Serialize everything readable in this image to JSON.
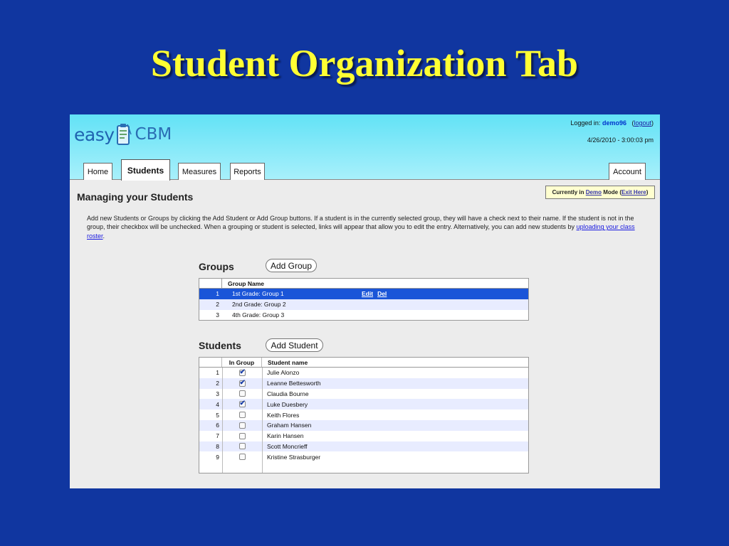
{
  "slide": {
    "title": "Student Organization Tab"
  },
  "app": {
    "logo_easy": "easy",
    "logo_cbm": "CBM",
    "login_prefix": "Logged in:",
    "username": "demo96",
    "logout_label": "logout",
    "datetime": "4/26/2010 - 3:00:03 pm"
  },
  "tabs": [
    "Home",
    "Students",
    "Measures",
    "Reports",
    "Account"
  ],
  "page": {
    "title": "Managing your Students",
    "demo_prefix": "Currently in",
    "demo_link": "Demo",
    "demo_mode": "Mode (",
    "demo_exit": "Exit Here",
    "demo_suffix": ")",
    "intro": "Add new Students or Groups by clicking the Add Student or Add Group buttons. If a student is in the currently selected group, they will have a check next to their name. If the student is not in the group, their checkbox will be unchecked. When a grouping or student is selected, links will appear that allow you to edit the entry. Alternatively, you can add new students by",
    "intro_link": "uploading your class roster",
    "intro_end": "."
  },
  "groups": {
    "title": "Groups",
    "add_label": "Add Group",
    "col_header": "Group Name",
    "edit_label": "Edit",
    "del_label": "Del",
    "rows": [
      {
        "num": "1",
        "name": "1st Grade: Group 1"
      },
      {
        "num": "2",
        "name": "2nd Grade: Group 2"
      },
      {
        "num": "3",
        "name": "4th Grade: Group 3"
      }
    ]
  },
  "students": {
    "title": "Students",
    "add_label": "Add Student",
    "col_in_group": "In Group",
    "col_name": "Student name",
    "rows": [
      {
        "num": "1",
        "name": "Julie Alonzo",
        "in_group": true
      },
      {
        "num": "2",
        "name": "Leanne Bettesworth",
        "in_group": true
      },
      {
        "num": "3",
        "name": "Claudia Bourne",
        "in_group": false
      },
      {
        "num": "4",
        "name": "Luke Duesbery",
        "in_group": true
      },
      {
        "num": "5",
        "name": "Keith Flores",
        "in_group": false
      },
      {
        "num": "6",
        "name": "Graham Hansen",
        "in_group": false
      },
      {
        "num": "7",
        "name": "Karin Hansen",
        "in_group": false
      },
      {
        "num": "8",
        "name": "Scott Moncrieff",
        "in_group": false
      },
      {
        "num": "9",
        "name": "Kristine Strasburger",
        "in_group": false
      }
    ]
  }
}
